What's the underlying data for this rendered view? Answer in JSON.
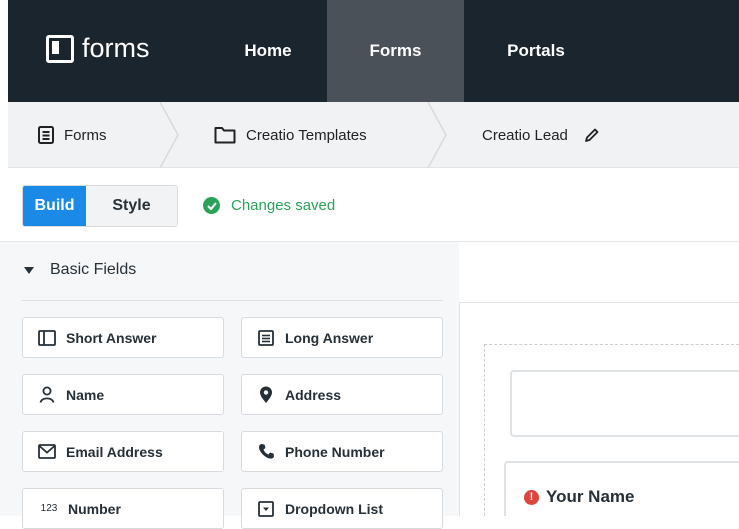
{
  "app": {
    "logo_text": "forms"
  },
  "nav": {
    "home": "Home",
    "forms": "Forms",
    "portals": "Portals"
  },
  "breadcrumb": {
    "forms": "Forms",
    "folder": "Creatio Templates",
    "current": "Creatio Lead"
  },
  "toolbar": {
    "build": "Build",
    "style": "Style",
    "status": "Changes saved"
  },
  "sidebar": {
    "section_title": "Basic Fields",
    "fields": [
      {
        "label": "Short Answer",
        "icon": "short-answer-icon"
      },
      {
        "label": "Long Answer",
        "icon": "long-answer-icon"
      },
      {
        "label": "Name",
        "icon": "person-icon"
      },
      {
        "label": "Address",
        "icon": "location-pin-icon"
      },
      {
        "label": "Email Address",
        "icon": "envelope-icon"
      },
      {
        "label": "Phone Number",
        "icon": "phone-icon"
      },
      {
        "label": "Number",
        "icon": "number-icon",
        "icon_text": "123"
      },
      {
        "label": "Dropdown List",
        "icon": "dropdown-icon"
      }
    ]
  },
  "canvas": {
    "field_label": "Your Name",
    "required_marker": "!"
  },
  "colors": {
    "topbar": "#1b252d",
    "accent": "#1a8ae6",
    "success": "#2aa25a",
    "required": "#e0443c"
  }
}
